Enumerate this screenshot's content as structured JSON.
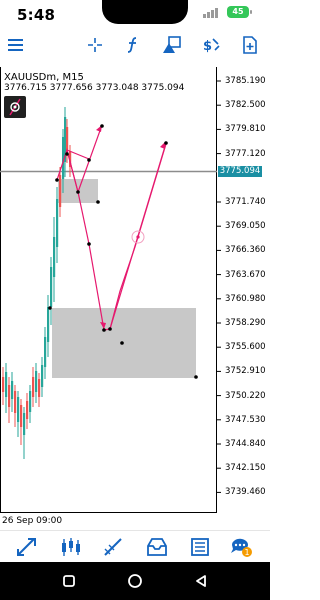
{
  "status_bar": {
    "time": "5:48",
    "battery": "45"
  },
  "toolbar": {
    "icons": [
      "menu-icon",
      "crosshair-icon",
      "function-icon",
      "objects-icon",
      "timeframe-icon",
      "new-order-icon"
    ]
  },
  "chart": {
    "symbol": "XAUUSDm, M15",
    "ohlc": "3776.715 3777.656 3773.048 3775.094",
    "current_price": "3775.094",
    "time_label": "26 Sep 09:00",
    "price_labels": [
      "3785.190",
      "3782.500",
      "3779.810",
      "3777.120",
      "3771.740",
      "3769.050",
      "3766.360",
      "3763.670",
      "3760.980",
      "3758.290",
      "3755.600",
      "3752.910",
      "3750.220",
      "3747.530",
      "3744.840",
      "3742.150",
      "3739.460"
    ],
    "colors": {
      "bull": "#26a69a",
      "bear": "#ef5350",
      "drawing": "#e6196e",
      "zone": "#c8c8c8",
      "price_line": "#8c8c8c",
      "price_tag": "#1a8fa3"
    }
  },
  "bottom_tabs": {
    "icons": [
      "quotes-icon",
      "chart-icon",
      "trade-icon",
      "history-icon",
      "news-icon",
      "messages-icon"
    ],
    "messages_badge": "1"
  },
  "nav": {
    "icons": [
      "recents-icon",
      "home-icon",
      "back-icon"
    ]
  }
}
